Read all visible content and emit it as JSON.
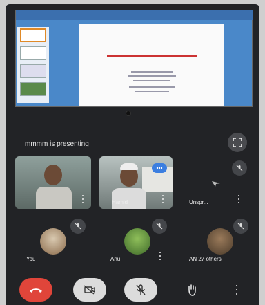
{
  "presentation": {
    "presenting_label": "mmmm is presenting"
  },
  "participants": [
    {
      "name": "",
      "type": "video"
    },
    {
      "name": "Hamid",
      "type": "video"
    },
    {
      "name": "Unspr...",
      "type": "avatar"
    },
    {
      "name": "You",
      "type": "avatar"
    },
    {
      "name": "Anu",
      "type": "avatar"
    },
    {
      "name": "AN   27 others",
      "type": "avatar"
    }
  ],
  "colors": {
    "end_call": "#e0453a",
    "control_light": "#dcdcdc",
    "speaking_badge": "#3b7ee0",
    "shared_screen_bg": "#4a88c9"
  },
  "controls": [
    {
      "icon": "phone-hangup-icon"
    },
    {
      "icon": "camera-off-icon"
    },
    {
      "icon": "mic-off-icon"
    },
    {
      "icon": "raise-hand-icon"
    },
    {
      "icon": "more-options-icon"
    }
  ]
}
